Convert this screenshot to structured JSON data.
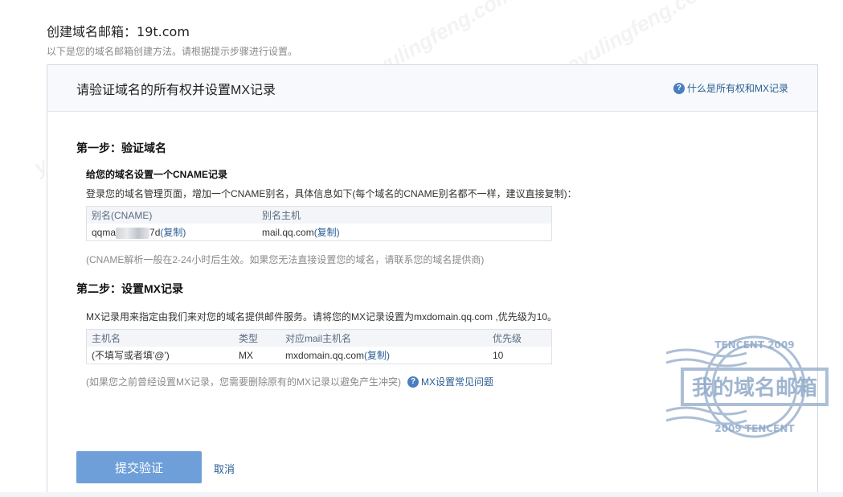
{
  "header": {
    "title_prefix": "创建域名邮箱：",
    "domain": "19t.com",
    "subtitle": "以下是您的域名邮箱创建方法。请根据提示步骤进行设置。"
  },
  "panel": {
    "title": "请验证域名的所有权并设置MX记录",
    "help_link": "什么是所有权和MX记录"
  },
  "step1": {
    "title": "第一步：验证域名",
    "subtitle": "给您的域名设置一个CNAME记录",
    "desc": "登录您的域名管理页面，增加一个CNAME别名，具体信息如下(每个域名的CNAME别名都不一样，建议直接复制)：",
    "table": {
      "headers": [
        "别名(CNAME)",
        "别名主机"
      ],
      "cname_prefix": "qqma",
      "cname_suffix": "7d",
      "host": "mail.qq.com",
      "copy_label": "(复制)"
    },
    "note": "(CNAME解析一般在2-24小时后生效。如果您无法直接设置您的域名，请联系您的域名提供商)"
  },
  "step2": {
    "title": "第二步：设置MX记录",
    "desc": "MX记录用来指定由我们来对您的域名提供邮件服务。请将您的MX记录设置为mxdomain.qq.com ,优先级为10。",
    "table": {
      "headers": [
        "主机名",
        "类型",
        "对应mail主机名",
        "优先级"
      ],
      "row": {
        "host": "(不填写或者填'@')",
        "type": "MX",
        "mail_host": "mxdomain.qq.com",
        "priority": "10"
      },
      "copy_label": "(复制)"
    },
    "note": "(如果您之前曾经设置MX记录，您需要删除原有的MX记录以避免产生冲突)",
    "help_link": "MX设置常见问题"
  },
  "actions": {
    "submit": "提交验证",
    "cancel": "取消"
  },
  "stamp": {
    "text": "我的域名邮箱",
    "arc_top": "TENCENT 2009",
    "arc_bottom": "2009 TENCENT"
  },
  "colors": {
    "accent_button": "#6f9fd9",
    "link": "#2a5d92",
    "stamp": "#8fa9c8"
  }
}
